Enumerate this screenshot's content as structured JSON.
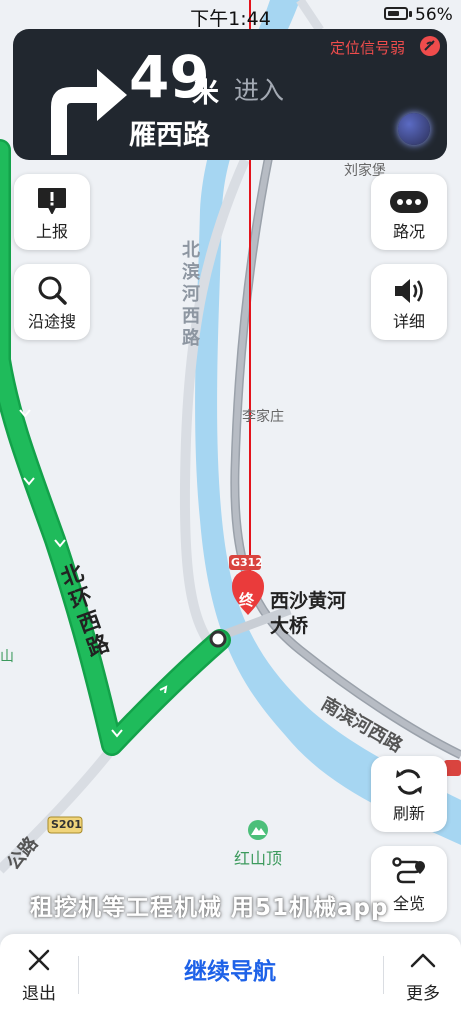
{
  "status": {
    "time": "下午1:44",
    "battery": "56%"
  },
  "guide": {
    "distance": "49",
    "unit": "米",
    "action": "进入",
    "road": "雁西路",
    "gps_status": "定位信号弱"
  },
  "left_buttons": [
    {
      "label": "上报"
    },
    {
      "label": "沿途搜"
    }
  ],
  "right_buttons": [
    {
      "label": "路况"
    },
    {
      "label": "详细"
    }
  ],
  "lower_right_buttons": [
    {
      "label": "刷新"
    },
    {
      "label": "全览"
    }
  ],
  "map": {
    "places": [
      "刘家堡",
      "李家庄",
      "红山顶"
    ],
    "destination_marker": "终",
    "destination_name": "西沙黄河大桥",
    "roads": [
      "北滨河西路",
      "北环西路",
      "南滨河西路",
      "公路"
    ],
    "road_shields": [
      "G312",
      "S201"
    ],
    "left_edge_text": "山"
  },
  "bottom": {
    "exit_label": "退出",
    "continue_label": "继续导航",
    "more_label": "更多"
  },
  "watermark": "租挖机等工程机械 用51机械app",
  "colors": {
    "route_green": "#1fbb5b",
    "river": "#a6d6f2",
    "panel": "#21272f",
    "accent_blue": "#1e62e8",
    "warning_red": "#ef4c4c"
  }
}
